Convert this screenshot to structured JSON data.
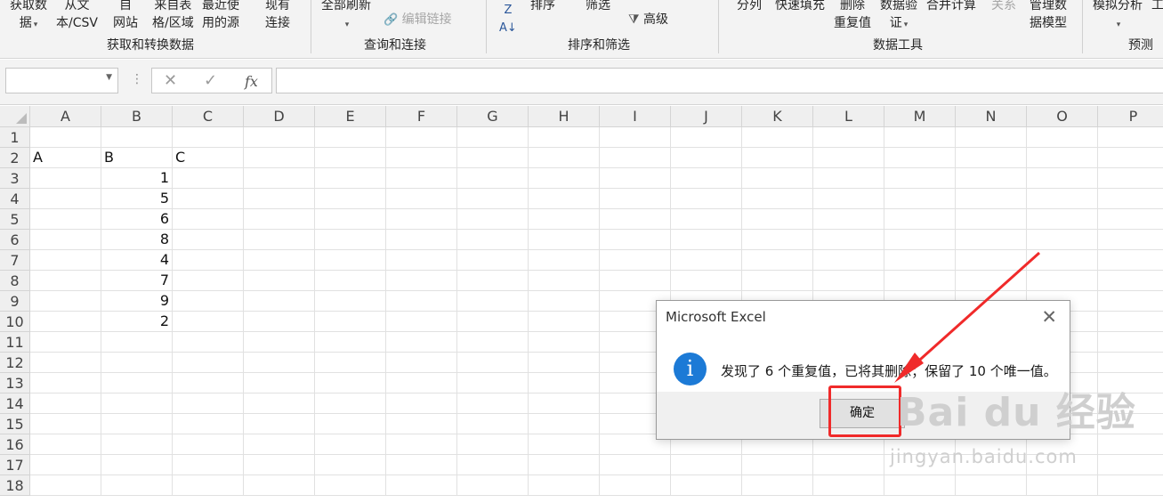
{
  "ribbon": {
    "items": [
      {
        "label": "获取数",
        "sub": "据",
        "dropdown": true
      },
      {
        "label": "从文",
        "sub": "本/CSV"
      },
      {
        "label": "自",
        "sub": "网站"
      },
      {
        "label": "来自表",
        "sub": "格/区域"
      },
      {
        "label": "最近使",
        "sub": "用的源"
      },
      {
        "label": "现有",
        "sub": "连接"
      },
      {
        "label": "全部刷新",
        "dropdown": true
      },
      {
        "label": "编辑链接"
      },
      {
        "label": "排序"
      },
      {
        "label": "筛选"
      },
      {
        "label": "高级"
      },
      {
        "label": "分列"
      },
      {
        "label": "快速填充"
      },
      {
        "label": "删除",
        "sub": "重复值"
      },
      {
        "label": "数据验",
        "sub": "证"
      },
      {
        "label": "合并计算"
      },
      {
        "label": "关系"
      },
      {
        "label": "管理数",
        "sub": "据模型"
      },
      {
        "label": "模拟分析"
      }
    ],
    "groups": [
      "获取和转换数据",
      "查询和连接",
      "排序和筛选",
      "数据工具",
      "预测"
    ],
    "extra_right_top": "",
    "extra_right_bottom": "工"
  },
  "formula_bar": {
    "name_box": "",
    "cancel_icon": "close-icon",
    "enter_icon": "check-icon",
    "fx_label": "fx",
    "formula": ""
  },
  "sheet": {
    "columns": [
      "A",
      "B",
      "C",
      "D",
      "E",
      "F",
      "G",
      "H",
      "I",
      "J",
      "K",
      "L",
      "M",
      "N",
      "O",
      "P"
    ],
    "rows": [
      "1",
      "2",
      "3",
      "4",
      "5",
      "6",
      "7",
      "8",
      "9",
      "10",
      "11",
      "12",
      "13",
      "14",
      "15",
      "16",
      "17",
      "18"
    ],
    "headers": {
      "A": "A",
      "B": "B",
      "C": "C"
    },
    "b_values": [
      "1",
      "5",
      "6",
      "8",
      "4",
      "7",
      "9",
      "2"
    ]
  },
  "dialog": {
    "title": "Microsoft Excel",
    "close_icon": "close-icon",
    "icon": "info-icon",
    "message": "发现了 6 个重复值，已将其删除；保留了 10 个唯一值。",
    "ok_label": "确定"
  },
  "annotation": {
    "highlight_color": "#f02a2a"
  },
  "watermark": {
    "brand": "Bai du 经验",
    "url": "jingyan.baidu.com"
  }
}
